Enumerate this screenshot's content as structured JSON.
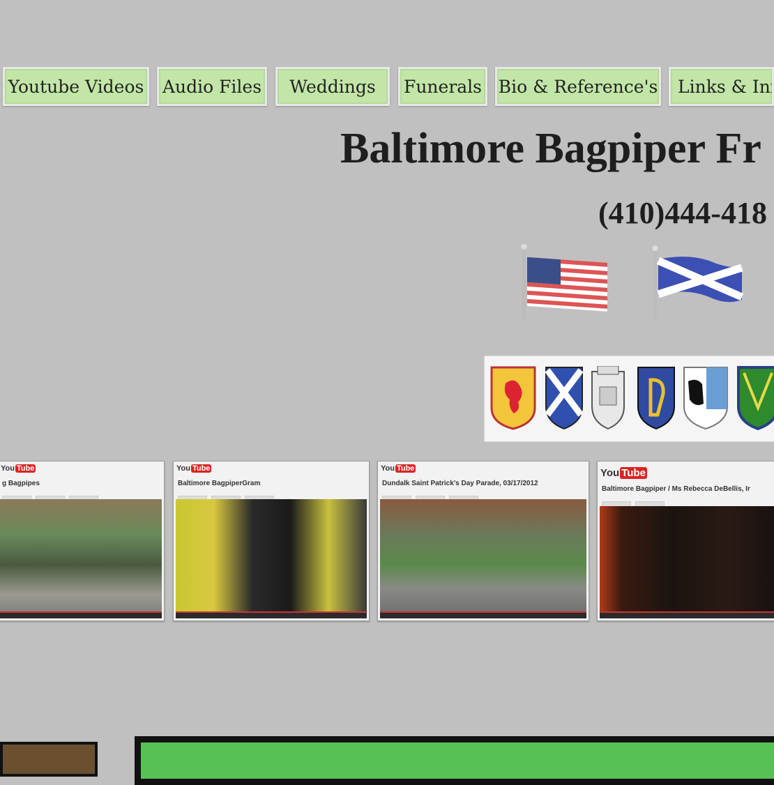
{
  "nav": {
    "tabs": [
      {
        "label": "Youtube Videos"
      },
      {
        "label": "Audio Files"
      },
      {
        "label": "Weddings"
      },
      {
        "label": "Funerals"
      },
      {
        "label": "Bio & Reference's"
      },
      {
        "label": "Links & Inf"
      }
    ]
  },
  "header": {
    "title": "Baltimore Bagpiper Fr",
    "phone": "(410)444-418"
  },
  "flags": [
    {
      "name": "us-flag-icon"
    },
    {
      "name": "scotland-flag-icon"
    }
  ],
  "crests": [
    {
      "name": "lion-rampant-crest"
    },
    {
      "name": "saltire-crest"
    },
    {
      "name": "castle-crest"
    },
    {
      "name": "harp-crest"
    },
    {
      "name": "eagle-crest"
    },
    {
      "name": "green-shield-crest"
    }
  ],
  "videos": [
    {
      "site": "You",
      "tube": "Tube",
      "title": "g Bagpipes"
    },
    {
      "site": "You",
      "tube": "Tube",
      "title": "Baltimore BagpiperGram"
    },
    {
      "site": "You",
      "tube": "Tube",
      "title": "Dundalk Saint Patrick's Day Parade, 03/17/2012"
    },
    {
      "site": "You",
      "tube": "Tube",
      "title": "Baltimore Bagpiper / Ms Rebecca DeBellis, Ir"
    }
  ],
  "colors": {
    "background": "#c0c0c0",
    "tab_fill": "#c2e6a7",
    "bottom_green": "#58c155"
  }
}
